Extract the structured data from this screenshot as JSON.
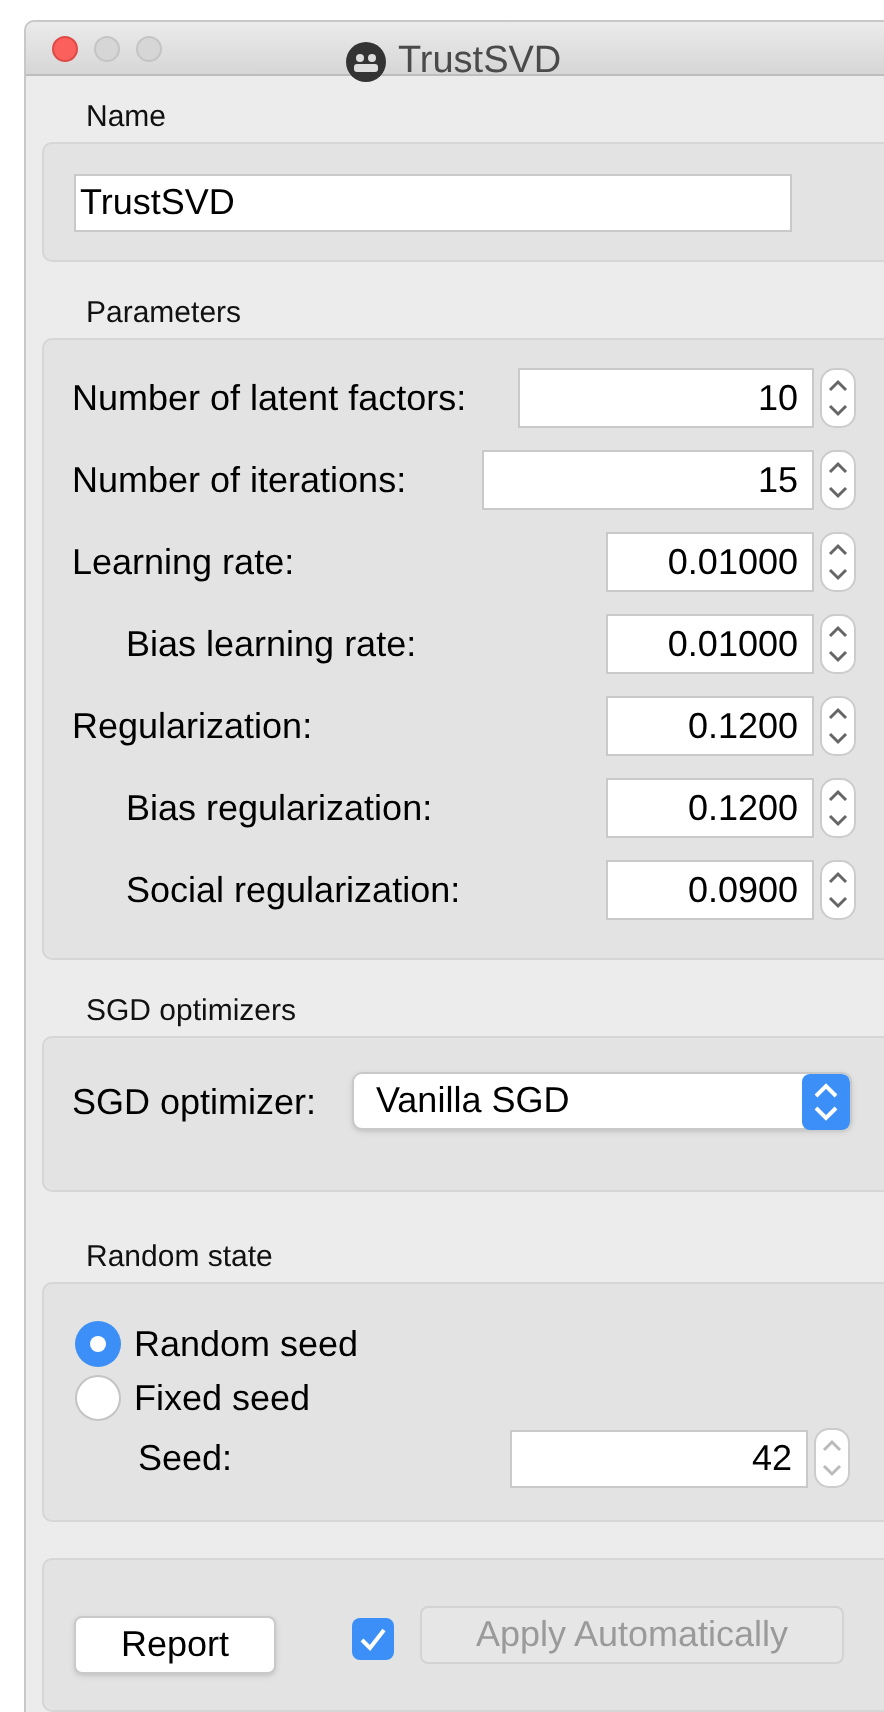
{
  "window": {
    "title": "TrustSVD"
  },
  "name_box": {
    "title": "Name",
    "value": "TrustSVD"
  },
  "parameters": {
    "title": "Parameters",
    "rows": [
      {
        "label": "Number of latent factors:",
        "value": "10",
        "kind": "int",
        "indented": false
      },
      {
        "label": "Number of iterations:",
        "value": "15",
        "kind": "int",
        "indented": false
      },
      {
        "label": "Learning rate:",
        "value": "0.01000",
        "kind": "float",
        "indented": false
      },
      {
        "label": "Bias learning rate:",
        "value": "0.01000",
        "kind": "float",
        "indented": true
      },
      {
        "label": "Regularization:",
        "value": "0.1200",
        "kind": "float",
        "indented": false
      },
      {
        "label": "Bias regularization:",
        "value": "0.1200",
        "kind": "float",
        "indented": true
      },
      {
        "label": "Social regularization:",
        "value": "0.0900",
        "kind": "float",
        "indented": true
      }
    ]
  },
  "sgd": {
    "title": "SGD optimizers",
    "label": "SGD optimizer:",
    "value": "Vanilla SGD"
  },
  "random_state": {
    "title": "Random state",
    "options": [
      {
        "label": "Random seed",
        "selected": true
      },
      {
        "label": "Fixed seed",
        "selected": false
      }
    ],
    "seed_label": "Seed:",
    "seed_value": "42"
  },
  "footer": {
    "report": "Report",
    "auto_apply": {
      "label": "Apply Automatically",
      "checked": true,
      "disabled": true
    }
  }
}
